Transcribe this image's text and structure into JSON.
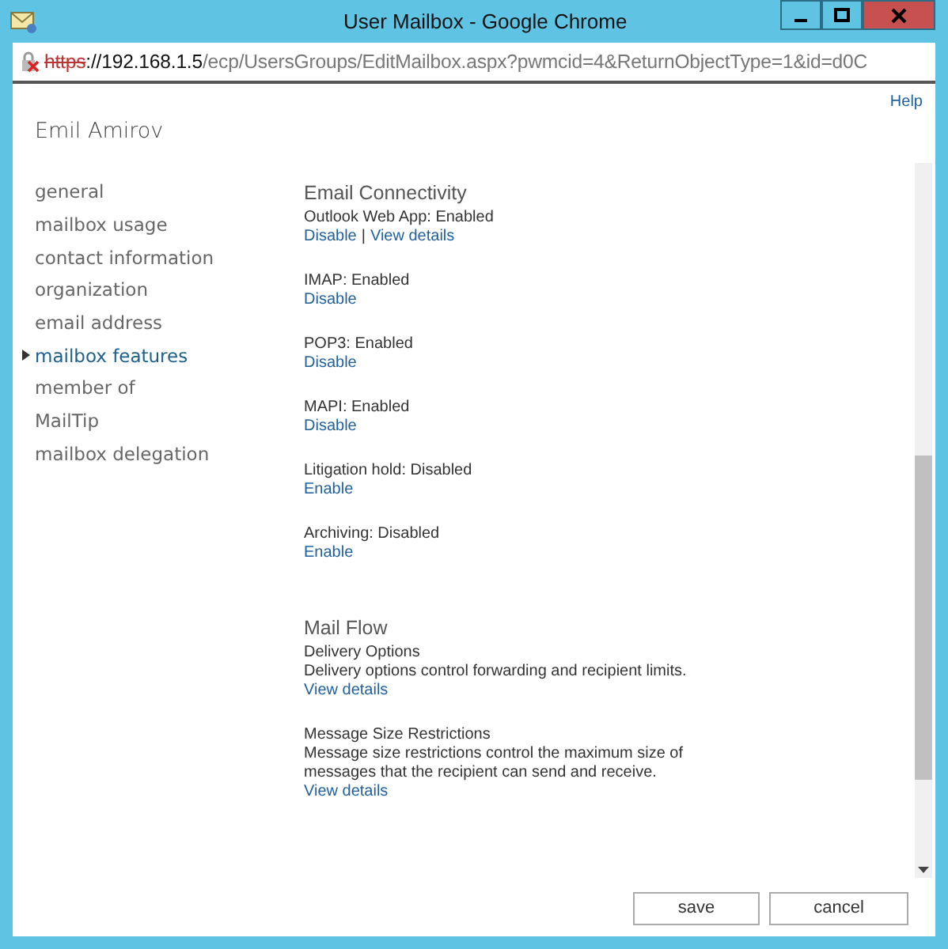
{
  "window": {
    "title": "User Mailbox - Google Chrome"
  },
  "address_bar": {
    "scheme": "https",
    "host": "://192.168.1.5",
    "path": "/ecp/UsersGroups/EditMailbox.aspx?pwmcid=4&ReturnObjectType=1&id=d0C",
    "insecure": true
  },
  "help_link": "Help",
  "user_name": "Emil Amirov",
  "sidebar": {
    "items": [
      {
        "label": "general",
        "selected": false
      },
      {
        "label": "mailbox usage",
        "selected": false
      },
      {
        "label": "contact information",
        "selected": false
      },
      {
        "label": "organization",
        "selected": false
      },
      {
        "label": "email address",
        "selected": false
      },
      {
        "label": "mailbox features",
        "selected": true
      },
      {
        "label": "member of",
        "selected": false
      },
      {
        "label": "MailTip",
        "selected": false
      },
      {
        "label": "mailbox delegation",
        "selected": false
      }
    ]
  },
  "link_separator": "|",
  "sections": [
    {
      "heading": "Email Connectivity",
      "items": [
        {
          "label": "Outlook Web App: Enabled",
          "links": [
            "Disable",
            "View details"
          ]
        },
        {
          "label": "IMAP: Enabled",
          "links": [
            "Disable"
          ]
        },
        {
          "label": "POP3: Enabled",
          "links": [
            "Disable"
          ]
        },
        {
          "label": "MAPI: Enabled",
          "links": [
            "Disable"
          ]
        },
        {
          "label": "Litigation hold: Disabled",
          "links": [
            "Enable"
          ]
        },
        {
          "label": "Archiving: Disabled",
          "links": [
            "Enable"
          ]
        }
      ]
    },
    {
      "heading": "Mail Flow",
      "items": [
        {
          "label": "Delivery Options",
          "description": "Delivery options control forwarding and recipient limits.",
          "links": [
            "View details"
          ]
        },
        {
          "label": "Message Size Restrictions",
          "description": "Message size restrictions control the maximum size of messages that the recipient can send and receive.",
          "links": [
            "View details"
          ]
        }
      ]
    }
  ],
  "buttons": [
    "save",
    "cancel"
  ]
}
